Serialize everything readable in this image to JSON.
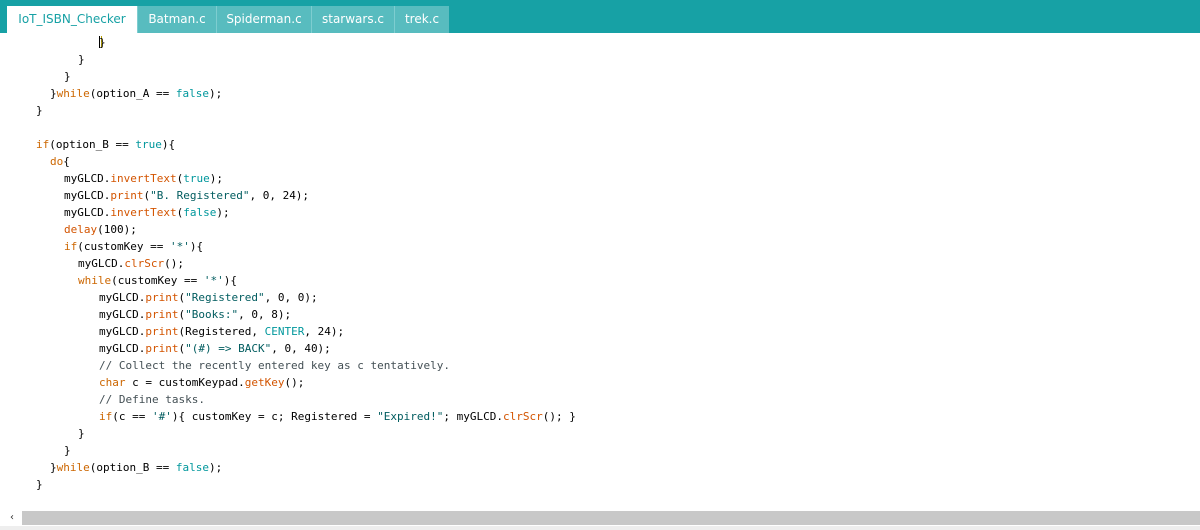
{
  "tabs": [
    {
      "label": "IoT_ISBN_Checker",
      "active": true
    },
    {
      "label": "Batman.c",
      "active": false
    },
    {
      "label": "Spiderman.c",
      "active": false
    },
    {
      "label": "starwars.c",
      "active": false
    },
    {
      "label": "trek.c",
      "active": false
    }
  ],
  "code": {
    "kw_do": "do",
    "kw_while": "while",
    "kw_if": "if",
    "kw_char": "char",
    "lit_true": "true",
    "lit_false": "false",
    "lit_center": "CENTER",
    "fn_invertText": "invertText",
    "fn_print": "print",
    "fn_delay": "delay",
    "fn_clrScr": "clrScr",
    "fn_getKey": "getKey",
    "str_b_registered": "\"B. Registered\"",
    "str_registered": "\"Registered\"",
    "str_books": "\"Books:\"",
    "str_back": "\"(#) => BACK\"",
    "str_expired": "\"Expired!\"",
    "chr_star": "'*'",
    "chr_hash": "'#'",
    "comment_collect": "// Collect the recently entered key as c tentatively.",
    "comment_define": "// Define tasks."
  },
  "colors": {
    "tabbar": "#17a1a5",
    "keyword": "#cc6600",
    "literal": "#00979c",
    "comment": "#434f54"
  },
  "icons": {
    "scroll_left": "scroll-left-arrow-icon"
  }
}
